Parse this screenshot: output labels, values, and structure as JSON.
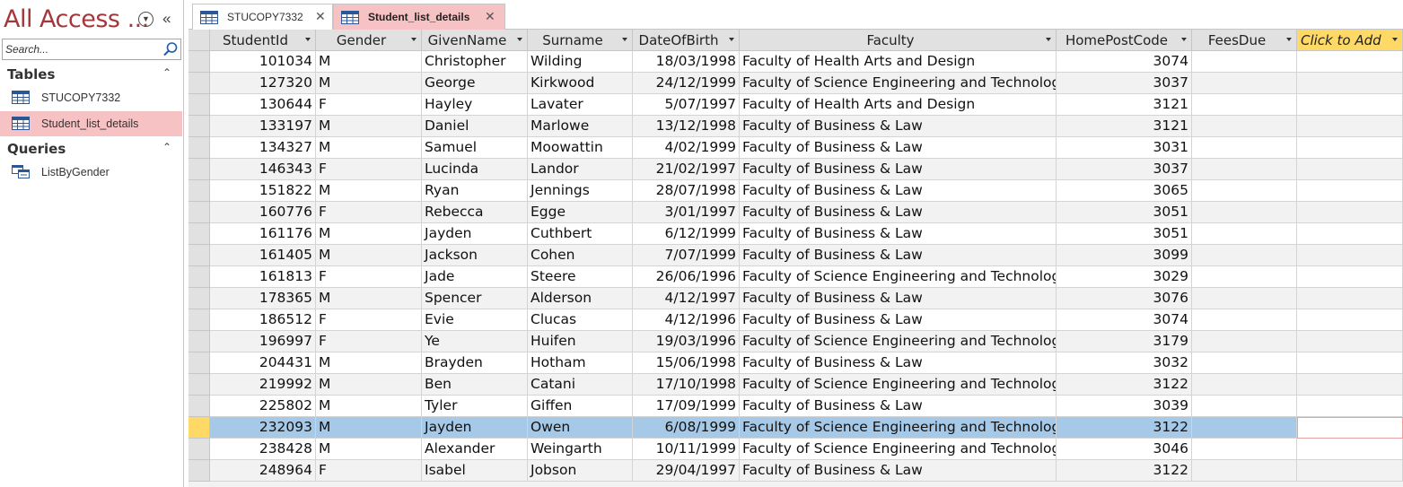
{
  "nav": {
    "title": "All Access ...",
    "search_placeholder": "Search...",
    "groups": [
      {
        "label": "Tables",
        "items": [
          {
            "label": "STUCOPY7332",
            "icon": "table-icon",
            "selected": false
          },
          {
            "label": "Student_list_details",
            "icon": "table-icon",
            "selected": true
          }
        ]
      },
      {
        "label": "Queries",
        "items": [
          {
            "label": "ListByGender",
            "icon": "query-icon",
            "selected": false
          }
        ]
      }
    ]
  },
  "tabs": [
    {
      "label": "STUCOPY7332",
      "active": false
    },
    {
      "label": "Student_list_details",
      "active": true
    }
  ],
  "table": {
    "columns": [
      {
        "label": "StudentId",
        "align": "right"
      },
      {
        "label": "Gender",
        "align": "left"
      },
      {
        "label": "GivenName",
        "align": "left"
      },
      {
        "label": "Surname",
        "align": "left"
      },
      {
        "label": "DateOfBirth",
        "align": "right"
      },
      {
        "label": "Faculty",
        "align": "left"
      },
      {
        "label": "HomePostCode",
        "align": "right"
      },
      {
        "label": "FeesDue",
        "align": "right"
      },
      {
        "label": "Click to Add",
        "align": "left"
      }
    ],
    "selected_row": 17,
    "rows": [
      [
        "101034",
        "M",
        "Christopher",
        "Wilding",
        "18/03/1998",
        "Faculty of Health Arts and Design",
        "3074",
        ""
      ],
      [
        "127320",
        "M",
        "George",
        "Kirkwood",
        "24/12/1999",
        "Faculty of Science Engineering and Technology",
        "3037",
        ""
      ],
      [
        "130644",
        "F",
        "Hayley",
        "Lavater",
        "5/07/1997",
        "Faculty of Health Arts and Design",
        "3121",
        ""
      ],
      [
        "133197",
        "M",
        "Daniel",
        "Marlowe",
        "13/12/1998",
        "Faculty of Business & Law",
        "3121",
        ""
      ],
      [
        "134327",
        "M",
        "Samuel",
        "Moowattin",
        "4/02/1999",
        "Faculty of Business & Law",
        "3031",
        ""
      ],
      [
        "146343",
        "F",
        "Lucinda",
        "Landor",
        "21/02/1997",
        "Faculty of Business & Law",
        "3037",
        ""
      ],
      [
        "151822",
        "M",
        "Ryan",
        "Jennings",
        "28/07/1998",
        "Faculty of Business & Law",
        "3065",
        ""
      ],
      [
        "160776",
        "F",
        "Rebecca",
        "Egge",
        "3/01/1997",
        "Faculty of Business & Law",
        "3051",
        ""
      ],
      [
        "161176",
        "M",
        "Jayden",
        "Cuthbert",
        "6/12/1999",
        "Faculty of Business & Law",
        "3051",
        ""
      ],
      [
        "161405",
        "M",
        "Jackson",
        "Cohen",
        "7/07/1999",
        "Faculty of Business & Law",
        "3099",
        ""
      ],
      [
        "161813",
        "F",
        "Jade",
        "Steere",
        "26/06/1996",
        "Faculty of Science Engineering and Technology",
        "3029",
        ""
      ],
      [
        "178365",
        "M",
        "Spencer",
        "Alderson",
        "4/12/1997",
        "Faculty of Business & Law",
        "3076",
        ""
      ],
      [
        "186512",
        "F",
        "Evie",
        "Clucas",
        "4/12/1996",
        "Faculty of Business & Law",
        "3074",
        ""
      ],
      [
        "196997",
        "F",
        "Ye",
        "Huifen",
        "19/03/1996",
        "Faculty of Science Engineering and Technology",
        "3179",
        ""
      ],
      [
        "204431",
        "M",
        "Brayden",
        "Hotham",
        "15/06/1998",
        "Faculty of Business & Law",
        "3032",
        ""
      ],
      [
        "219992",
        "M",
        "Ben",
        "Catani",
        "17/10/1998",
        "Faculty of Science Engineering and Technology",
        "3122",
        ""
      ],
      [
        "225802",
        "M",
        "Tyler",
        "Giffen",
        "17/09/1999",
        "Faculty of Business & Law",
        "3039",
        ""
      ],
      [
        "232093",
        "M",
        "Jayden",
        "Owen",
        "6/08/1999",
        "Faculty of Science Engineering and Technology",
        "3122",
        ""
      ],
      [
        "238428",
        "M",
        "Alexander",
        "Weingarth",
        "10/11/1999",
        "Faculty of Science Engineering and Technology",
        "3046",
        ""
      ],
      [
        "248964",
        "F",
        "Isabel",
        "Jobson",
        "29/04/1997",
        "Faculty of Business & Law",
        "3122",
        ""
      ]
    ]
  },
  "colors": {
    "accent": "#a4373a",
    "selected_nav": "#f7c2c4",
    "row_highlight": "#a6c9e8",
    "add_column": "#ffd966"
  }
}
